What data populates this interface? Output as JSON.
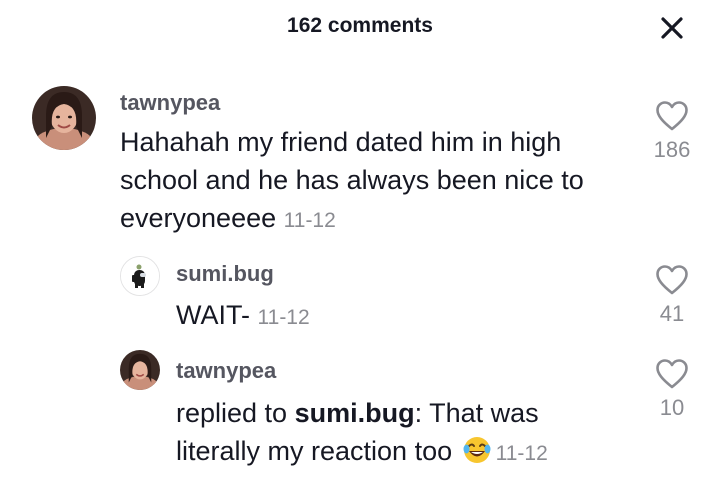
{
  "header": {
    "title": "162 comments",
    "close_icon": "close-icon"
  },
  "comments": [
    {
      "username": "tawnypea",
      "text": "Hahahah my friend dated him in high school and he has always been nice to everyoneeee",
      "date": "11-12",
      "likes": "186",
      "avatar": "user-photo-avatar"
    },
    {
      "username": "sumi.bug",
      "text": "WAIT-",
      "date": "11-12",
      "likes": "41",
      "avatar": "among-us-character-avatar"
    },
    {
      "username": "tawnypea",
      "reply_prefix": "replied to ",
      "reply_to": "sumi.bug",
      "text": ": That was literally my reaction too",
      "emoji": "tears-of-joy-emoji",
      "date": "11-12",
      "likes": "10",
      "avatar": "user-photo-avatar"
    }
  ],
  "colors": {
    "text": "#161823",
    "secondary": "#8a8b91",
    "username": "#555660"
  }
}
